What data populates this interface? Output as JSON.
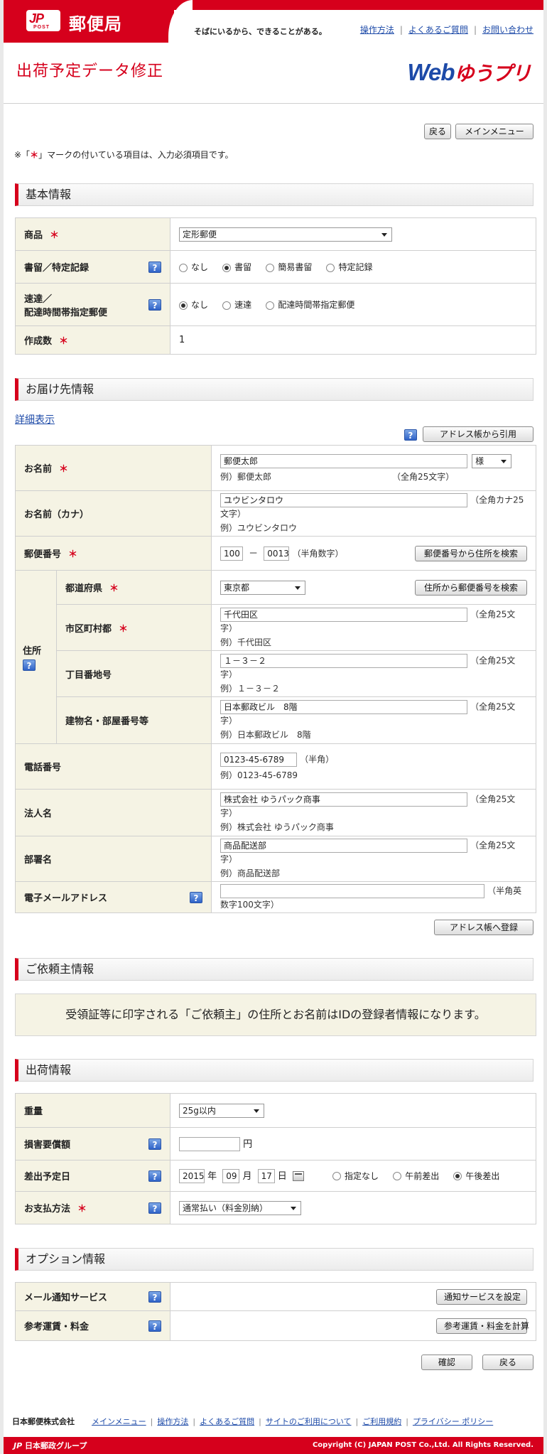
{
  "header": {
    "logo_name": "郵便局",
    "logo_jp": "JP",
    "logo_post": "POST",
    "tagline": "そばにいるから、できることがある。",
    "links": [
      "操作方法",
      "よくあるご質問",
      "お問い合わせ"
    ],
    "page_title": "出荷予定データ修正",
    "brand_web": "Web",
    "brand_yu": "ゆうプリ"
  },
  "top_actions": {
    "back": "戻る",
    "main_menu": "メインメニュー"
  },
  "required_note": {
    "prefix": "※「",
    "mark": "＊",
    "suffix": "」マークの付いている項目は、入力必須項目です。"
  },
  "basic": {
    "heading": "基本情報",
    "product_label": "商品",
    "product_value": "定形郵便",
    "registered_label": "書留／特定記録",
    "registered_options": [
      "なし",
      "書留",
      "簡易書留",
      "特定記録"
    ],
    "registered_selected": 1,
    "express_label_1": "速達／",
    "express_label_2": "配達時間帯指定郵便",
    "express_options": [
      "なし",
      "速達",
      "配達時間帯指定郵便"
    ],
    "express_selected": 0,
    "count_label": "作成数",
    "count_value": "1"
  },
  "recipient": {
    "heading": "お届け先情報",
    "detail_link": "詳細表示",
    "addressbook_button": "アドレス帳から引用",
    "name_label": "お名前",
    "name_value": "郵便太郎",
    "honorific": "様",
    "name_example": "例）郵便太郎",
    "name_hint": "（全角25文字）",
    "kana_label": "お名前（カナ）",
    "kana_value": "ユウビンタロウ",
    "kana_hint": "（全角カナ25文字）",
    "kana_example": "例）ユウビンタロウ",
    "zip_label": "郵便番号",
    "zip1": "100",
    "zip_dash": "－",
    "zip2": "0013",
    "zip_hint": "（半角数字）",
    "zip_search_button": "郵便番号から住所を検索",
    "address_label": "住所",
    "pref_label": "都道府県",
    "pref_value": "東京都",
    "addr_search_button": "住所から郵便番号を検索",
    "city_label": "市区町村都",
    "city_value": "千代田区",
    "city_hint": "（全角25文字）",
    "city_example": "例）千代田区",
    "block_label": "丁目番地号",
    "block_value": "１－３－２",
    "block_hint": "（全角25文字）",
    "block_example": "例）１－３－２",
    "building_label": "建物名・部屋番号等",
    "building_value": "日本郵政ビル　8階",
    "building_hint": "（全角25文字）",
    "building_example": "例）日本郵政ビル　8階",
    "phone_label": "電話番号",
    "phone_value": "0123-45-6789",
    "phone_hint": "（半角）",
    "phone_example": "例）0123-45-6789",
    "corp_label": "法人名",
    "corp_value": "株式会社 ゆうパック商事",
    "corp_hint": "（全角25文字）",
    "corp_example": "例）株式会社 ゆうパック商事",
    "dept_label": "部署名",
    "dept_value": "商品配送部",
    "dept_hint": "（全角25文字）",
    "dept_example": "例）商品配送部",
    "email_label": "電子メールアドレス",
    "email_value": "",
    "email_hint": "（半角英数字100文字）",
    "register_button": "アドレス帳へ登録"
  },
  "sender": {
    "heading": "ご依頼主情報",
    "notice": "受領証等に印字される「ご依頼主」の住所とお名前はIDの登録者情報になります。"
  },
  "shipping": {
    "heading": "出荷情報",
    "weight_label": "重量",
    "weight_value": "25g以内",
    "damage_label": "損害要償額",
    "damage_value": "",
    "damage_unit": "円",
    "date_label": "差出予定日",
    "year": "2015",
    "year_unit": "年",
    "month": "09",
    "month_unit": "月",
    "day": "17",
    "day_unit": "日",
    "time_options": [
      "指定なし",
      "午前差出",
      "午後差出"
    ],
    "time_selected": 2,
    "payment_label": "お支払方法",
    "payment_value": "通常払い（料金別納）"
  },
  "options": {
    "heading": "オプション情報",
    "mail_label": "メール通知サービス",
    "mail_button": "通知サービスを設定",
    "fee_label": "参考運賃・料金",
    "fee_button": "参考運賃・料金を計算"
  },
  "bottom_actions": {
    "confirm": "確認",
    "back": "戻る"
  },
  "footer": {
    "company": "日本郵便株式会社",
    "links": [
      "メインメニュー",
      "操作方法",
      "よくあるご質問",
      "サイトのご利用について",
      "ご利用規約",
      "プライバシー ポリシー"
    ],
    "group": "日本郵政グループ",
    "copyright": "Copyright (C) JAPAN POST Co.,Ltd.  All Rights Reserved."
  },
  "colors": {
    "brand_red": "#d6001c",
    "link_blue": "#1d4aa8",
    "label_bg": "#f5f3e4"
  }
}
